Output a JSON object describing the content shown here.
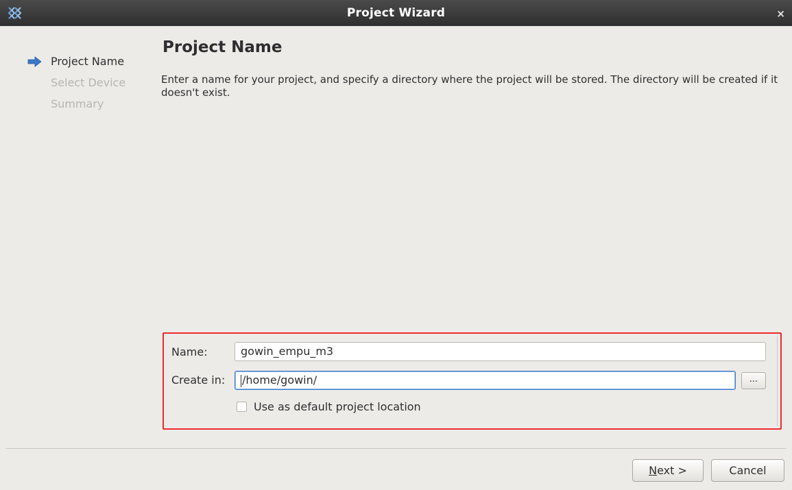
{
  "window": {
    "title": "Project Wizard",
    "icon": "gowin-logo-icon",
    "close_label": "×"
  },
  "steps": [
    {
      "label": "Project Name",
      "active": true
    },
    {
      "label": "Select Device",
      "active": false
    },
    {
      "label": "Summary",
      "active": false
    }
  ],
  "page": {
    "heading": "Project Name",
    "description": "Enter a name for your project, and specify a directory where the project will be stored. The directory will be created if it doesn't exist."
  },
  "form": {
    "name_label": "Name:",
    "name_value": "gowin_empu_m3",
    "create_in_label": "Create in:",
    "create_in_value": "/home/gowin/",
    "browse_label": "...",
    "default_location_label": "Use as default project location",
    "default_location_checked": false
  },
  "buttons": {
    "next_mnemonic": "N",
    "next_rest": "ext >",
    "cancel": "Cancel"
  },
  "colors": {
    "highlight_border": "#ef2b2b",
    "step_arrow": "#3b78c6"
  }
}
